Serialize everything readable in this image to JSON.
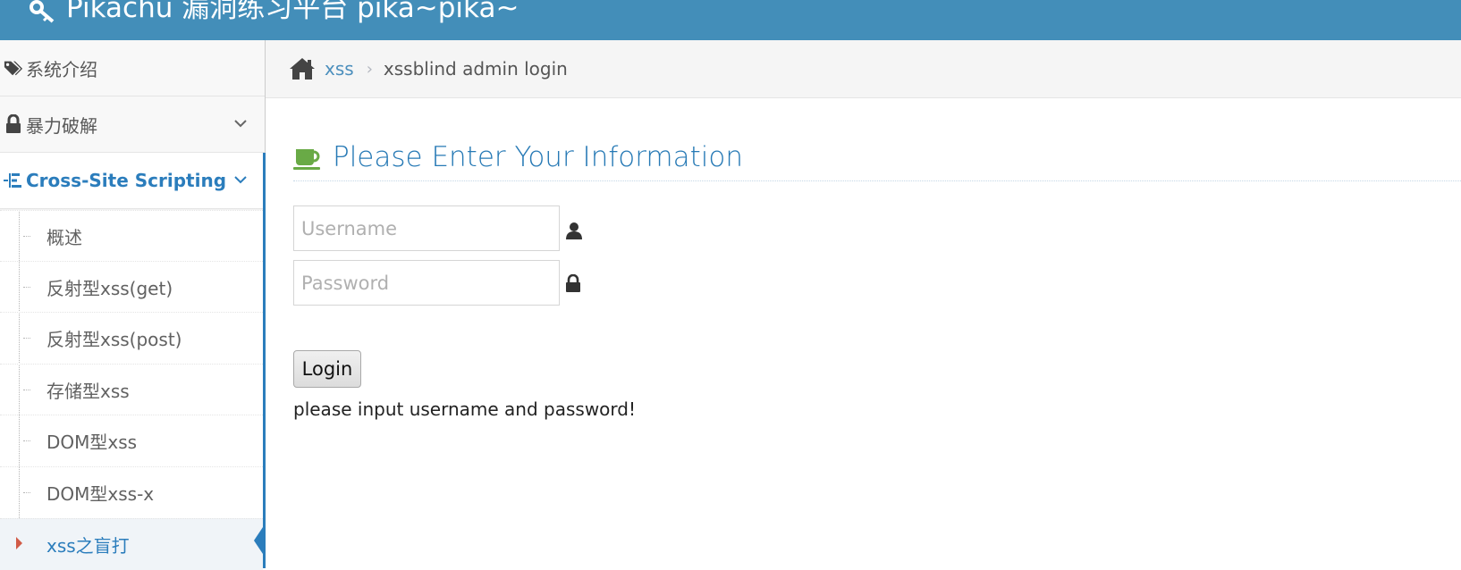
{
  "navbar": {
    "brand": "Pikachu 漏洞练习平台 pika~pika~",
    "bg_color": "#438eb9"
  },
  "sidebar": {
    "items": [
      {
        "label": "系统介绍",
        "icon": "tags-icon"
      },
      {
        "label": "暴力破解",
        "icon": "lock-icon",
        "has_submenu": true
      },
      {
        "label": "Cross-Site Scripting",
        "icon": "list-tree-icon",
        "has_submenu": true,
        "active": true
      }
    ],
    "submenu": [
      {
        "label": "概述"
      },
      {
        "label": "反射型xss(get)"
      },
      {
        "label": "反射型xss(post)"
      },
      {
        "label": "存储型xss"
      },
      {
        "label": "DOM型xss"
      },
      {
        "label": "DOM型xss-x"
      },
      {
        "label": "xss之盲打",
        "current": true
      }
    ],
    "active_color": "#2b7dbc"
  },
  "breadcrumbs": {
    "home_icon": "home-icon",
    "link": "xss",
    "separator": "›",
    "current": "xssblind admin login"
  },
  "main": {
    "title": "Please Enter Your Information",
    "title_icon": "coffee-cup-icon",
    "title_color": "#2679b5",
    "username_placeholder": "Username",
    "password_placeholder": "Password",
    "login_label": "Login",
    "message": "please input username and password!"
  }
}
